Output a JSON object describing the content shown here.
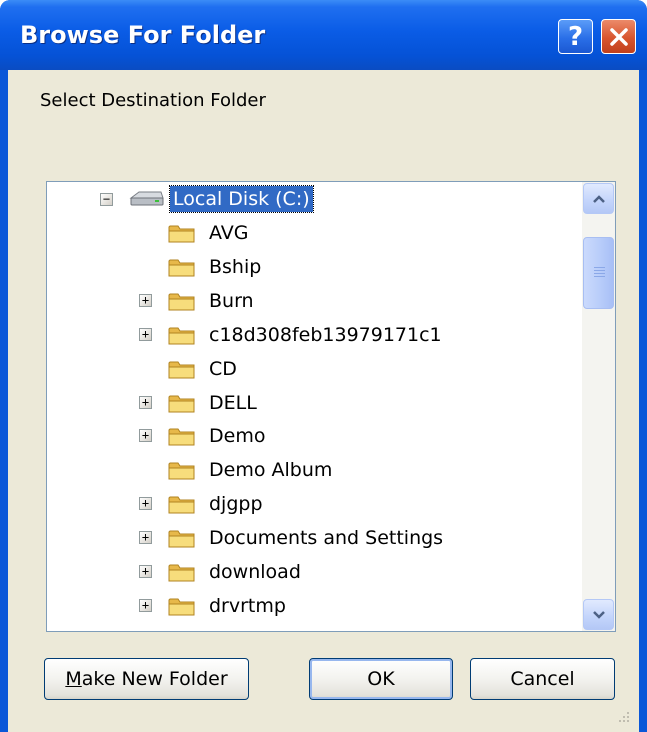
{
  "window": {
    "title": "Browse For Folder",
    "help_button": "?",
    "close_icon": "close-icon"
  },
  "dialog": {
    "instruction": "Select Destination Folder"
  },
  "tree": {
    "root": {
      "label": "Local Disk (C:)",
      "expanded": true,
      "selected": true,
      "icon": "drive-icon"
    },
    "items": [
      {
        "label": "AVG",
        "has_children": false
      },
      {
        "label": "Bship",
        "has_children": false
      },
      {
        "label": "Burn",
        "has_children": true
      },
      {
        "label": "c18d308feb13979171c1",
        "has_children": true
      },
      {
        "label": "CD",
        "has_children": false
      },
      {
        "label": "DELL",
        "has_children": true
      },
      {
        "label": "Demo",
        "has_children": true
      },
      {
        "label": "Demo Album",
        "has_children": false
      },
      {
        "label": "djgpp",
        "has_children": true
      },
      {
        "label": "Documents and Settings",
        "has_children": true
      },
      {
        "label": "download",
        "has_children": true
      },
      {
        "label": "drvrtmp",
        "has_children": true
      }
    ]
  },
  "buttons": {
    "make_new_folder": "Make New Folder",
    "ok": "OK",
    "cancel": "Cancel"
  },
  "colors": {
    "title_bar": "#0a5ce6",
    "selection": "#316ac5",
    "dialog_face": "#ece9d8",
    "folder": "#f5d66f"
  }
}
